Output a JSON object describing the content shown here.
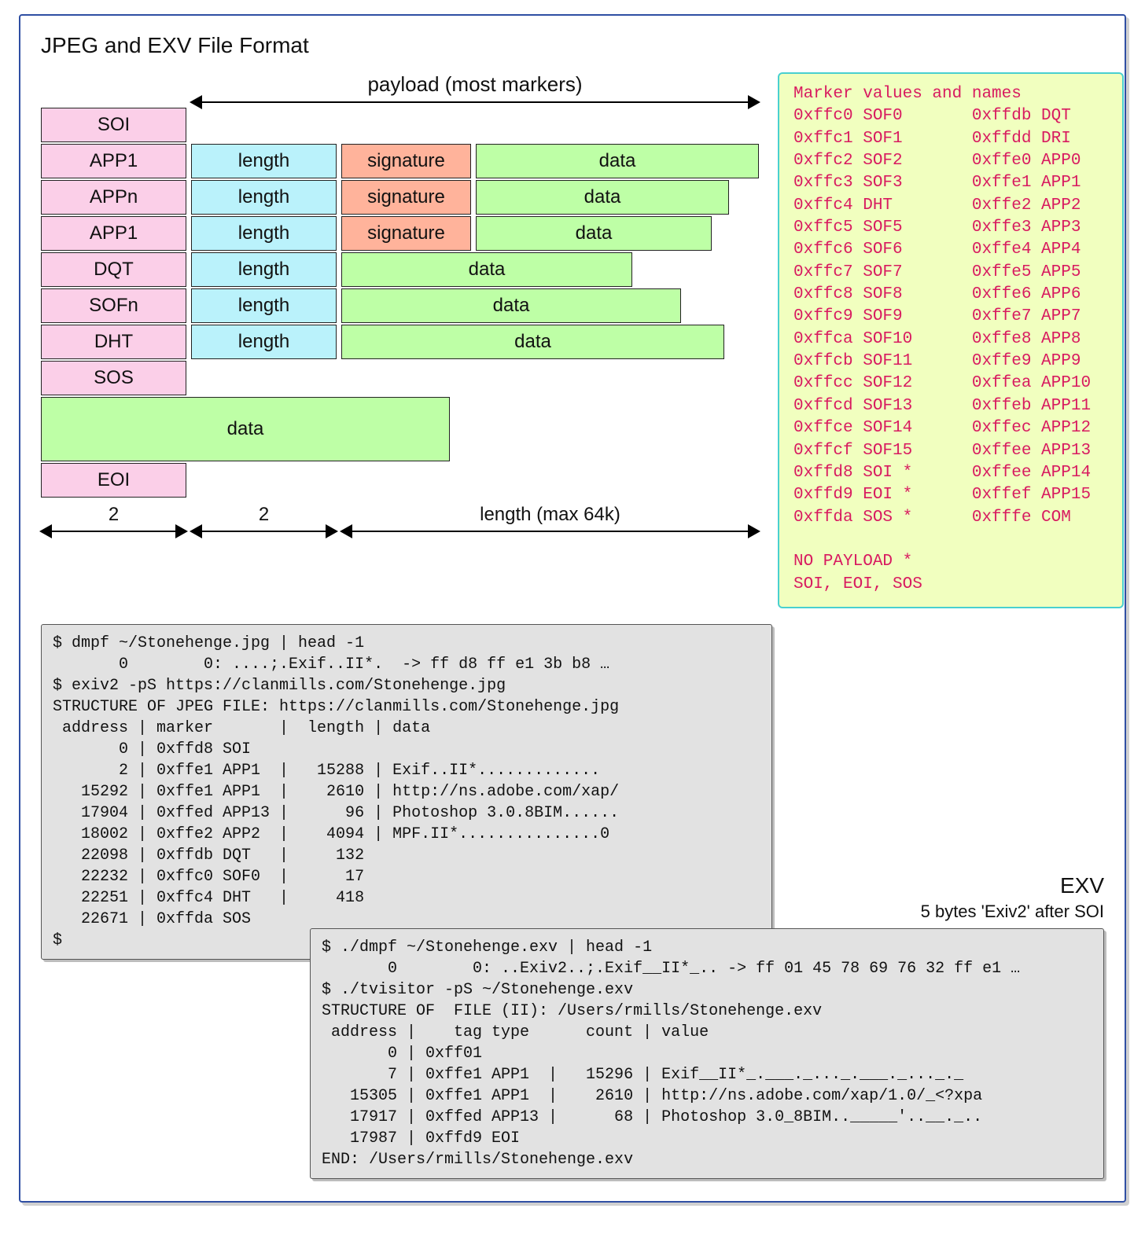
{
  "title": "JPEG and EXV File Format",
  "payload_label": "payload (most markers)",
  "segments": [
    {
      "marker": "SOI",
      "length": null,
      "sig": null,
      "data": null,
      "dataW": 0
    },
    {
      "marker": "APP1",
      "length": "length",
      "sig": "signature",
      "data": "data",
      "dataW": 360
    },
    {
      "marker": "APPn",
      "length": "length",
      "sig": "signature",
      "data": "data",
      "dataW": 322
    },
    {
      "marker": "APP1",
      "length": "length",
      "sig": "signature",
      "data": "data",
      "dataW": 300
    },
    {
      "marker": "DQT",
      "length": "length",
      "sig": null,
      "data": "data",
      "dataW": 370
    },
    {
      "marker": "SOFn",
      "length": "length",
      "sig": null,
      "data": "data",
      "dataW": 432
    },
    {
      "marker": "DHT",
      "length": "length",
      "sig": null,
      "data": "data",
      "dataW": 487
    },
    {
      "marker": "SOS",
      "length": null,
      "sig": null,
      "data": null,
      "dataW": 0
    }
  ],
  "big_data_label": "data",
  "big_data_width": 520,
  "eoi_label": "EOI",
  "scale": {
    "col1": "2",
    "col2": "2",
    "col3": "length (max 64k)"
  },
  "marker_table": {
    "heading": "Marker values and names",
    "left": [
      [
        "0xffc0",
        "SOF0"
      ],
      [
        "0xffc1",
        "SOF1"
      ],
      [
        "0xffc2",
        "SOF2"
      ],
      [
        "0xffc3",
        "SOF3"
      ],
      [
        "0xffc4",
        "DHT"
      ],
      [
        "0xffc5",
        "SOF5"
      ],
      [
        "0xffc6",
        "SOF6"
      ],
      [
        "0xffc7",
        "SOF7"
      ],
      [
        "0xffc8",
        "SOF8"
      ],
      [
        "0xffc9",
        "SOF9"
      ],
      [
        "0xffca",
        "SOF10"
      ],
      [
        "0xffcb",
        "SOF11"
      ],
      [
        "0xffcc",
        "SOF12"
      ],
      [
        "0xffcd",
        "SOF13"
      ],
      [
        "0xffce",
        "SOF14"
      ],
      [
        "0xffcf",
        "SOF15"
      ],
      [
        "0xffd8",
        "SOI *"
      ],
      [
        "0xffd9",
        "EOI *"
      ],
      [
        "0xffda",
        "SOS *"
      ]
    ],
    "right": [
      [
        "0xffdb",
        "DQT"
      ],
      [
        "0xffdd",
        "DRI"
      ],
      [
        "0xffe0",
        "APP0"
      ],
      [
        "0xffe1",
        "APP1"
      ],
      [
        "0xffe2",
        "APP2"
      ],
      [
        "0xffe3",
        "APP3"
      ],
      [
        "0xffe4",
        "APP4"
      ],
      [
        "0xffe5",
        "APP5"
      ],
      [
        "0xffe6",
        "APP6"
      ],
      [
        "0xffe7",
        "APP7"
      ],
      [
        "0xffe8",
        "APP8"
      ],
      [
        "0xffe9",
        "APP9"
      ],
      [
        "0xffea",
        "APP10"
      ],
      [
        "0xffeb",
        "APP11"
      ],
      [
        "0xffec",
        "APP12"
      ],
      [
        "0xffee",
        "APP13"
      ],
      [
        "0xffee",
        "APP14"
      ],
      [
        "0xffef",
        "APP15"
      ],
      [
        "0xfffe",
        "COM"
      ]
    ],
    "note1": "NO PAYLOAD *",
    "note2": "SOI, EOI, SOS"
  },
  "term1_lines": [
    "$ dmpf ~/Stonehenge.jpg | head -1",
    "       0        0: ....;.Exif..II*.  -> ff d8 ff e1 3b b8 …",
    "$ exiv2 -pS https://clanmills.com/Stonehenge.jpg",
    "STRUCTURE OF JPEG FILE: https://clanmills.com/Stonehenge.jpg",
    " address | marker       |  length | data",
    "       0 | 0xffd8 SOI  ",
    "       2 | 0xffe1 APP1  |   15288 | Exif..II*.............",
    "   15292 | 0xffe1 APP1  |    2610 | http://ns.adobe.com/xap/",
    "   17904 | 0xffed APP13 |      96 | Photoshop 3.0.8BIM......",
    "   18002 | 0xffe2 APP2  |    4094 | MPF.II*...............0",
    "   22098 | 0xffdb DQT   |     132 ",
    "   22232 | 0xffc0 SOF0  |      17 ",
    "   22251 | 0xffc4 DHT   |     418 ",
    "   22671 | 0xffda SOS  ",
    "$"
  ],
  "exv_heading": "EXV",
  "exv_sub": "5 bytes 'Exiv2' after SOI",
  "term2_lines": [
    "$ ./dmpf ~/Stonehenge.exv | head -1",
    "       0        0: ..Exiv2..;.Exif__II*_.. -> ff 01 45 78 69 76 32 ff e1 …",
    "$ ./tvisitor -pS ~/Stonehenge.exv",
    "STRUCTURE OF  FILE (II): /Users/rmills/Stonehenge.exv",
    " address |    tag type      count | value",
    "       0 | 0xff01",
    "       7 | 0xffe1 APP1  |   15296 | Exif__II*_.___._..._.___._..._._",
    "   15305 | 0xffe1 APP1  |    2610 | http://ns.adobe.com/xap/1.0/_<?xpa",
    "   17917 | 0xffed APP13 |      68 | Photoshop 3.0_8BIM.._____'..__._..",
    "   17987 | 0xffd9 EOI",
    "END: /Users/rmills/Stonehenge.exv"
  ]
}
